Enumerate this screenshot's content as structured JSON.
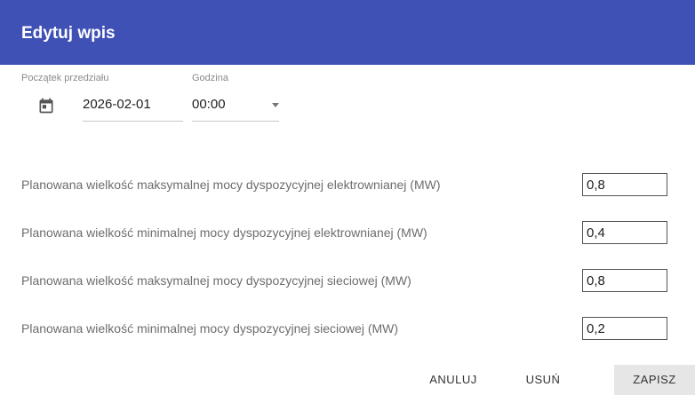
{
  "dialog": {
    "title": "Edytuj wpis"
  },
  "start": {
    "label": "Początek przedziału",
    "date": "2026-02-01",
    "icon": "calendar-icon"
  },
  "time": {
    "label": "Godzina",
    "value": "00:00"
  },
  "rows": [
    {
      "label": "Planowana wielkość maksymalnej mocy dyspozycyjnej elektrownianej (MW)",
      "value": "0,8"
    },
    {
      "label": "Planowana wielkość minimalnej mocy dyspozycyjnej elektrownianej (MW)",
      "value": "0,4"
    },
    {
      "label": "Planowana wielkość maksymalnej mocy dyspozycyjnej sieciowej (MW)",
      "value": "0,8"
    },
    {
      "label": "Planowana wielkość minimalnej mocy dyspozycyjnej sieciowej (MW)",
      "value": "0,2"
    }
  ],
  "actions": {
    "cancel": "ANULUJ",
    "delete": "USUŃ",
    "save": "ZAPISZ"
  },
  "colors": {
    "header": "#3f51b5"
  }
}
